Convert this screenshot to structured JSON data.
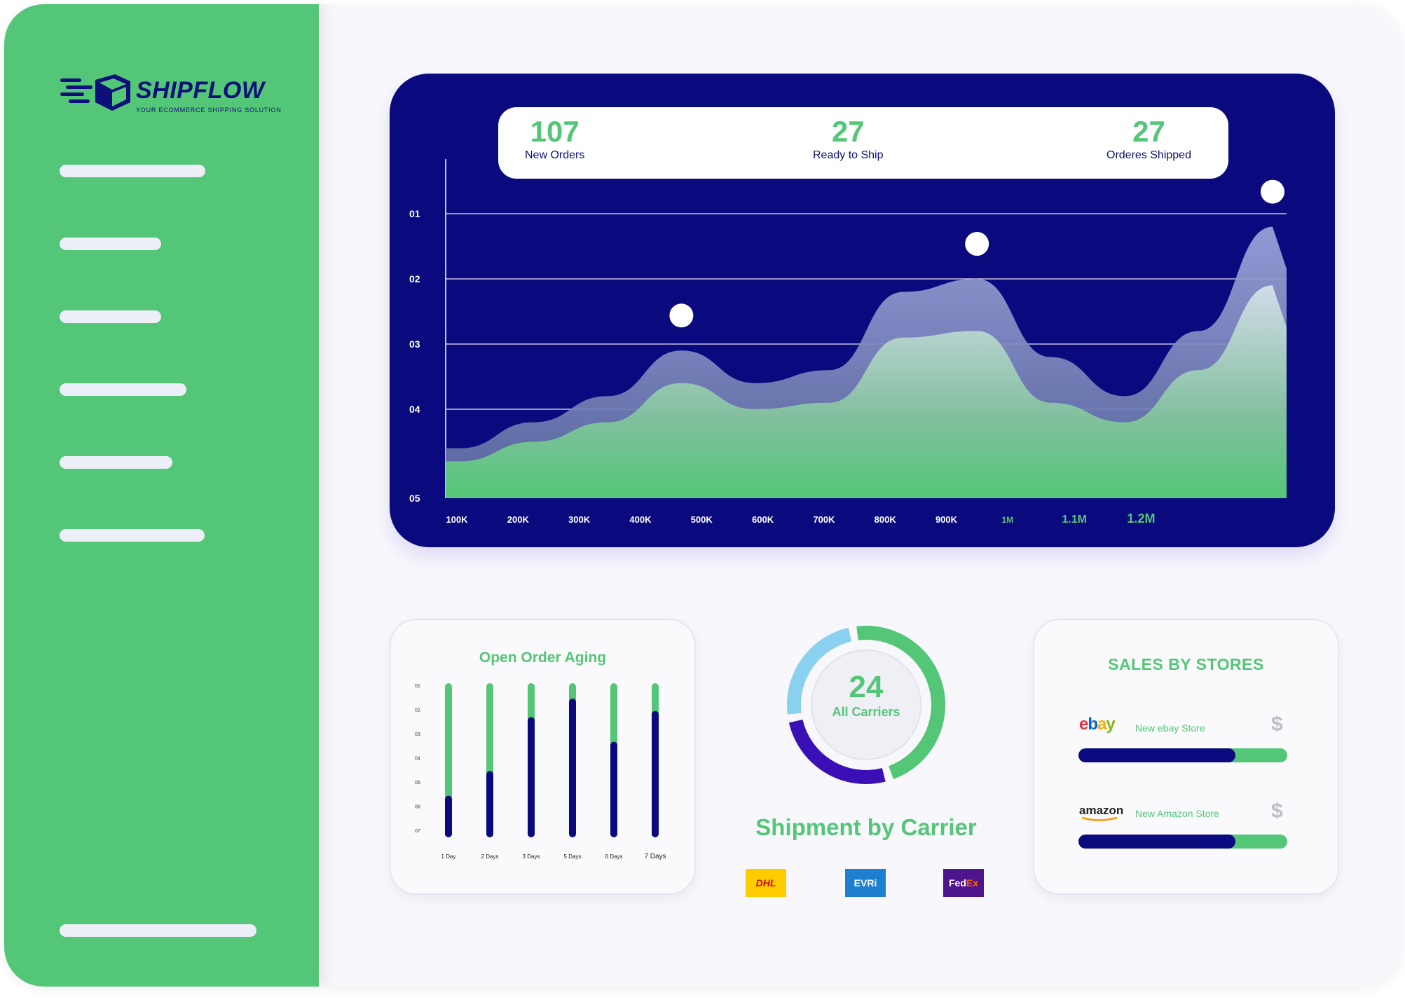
{
  "brand": {
    "name": "SHIPFLOW",
    "tagline": "YOUR ECOMMERCE SHIPPING SOLUTION"
  },
  "stats": [
    {
      "value": "107",
      "label": "New Orders"
    },
    {
      "value": "27",
      "label": "Ready to Ship"
    },
    {
      "value": "27",
      "label": "Orderes Shipped"
    }
  ],
  "chart_data": [
    {
      "type": "area",
      "y_tick_labels": [
        "01",
        "02",
        "03",
        "04",
        "05"
      ],
      "x_tick_labels": [
        "100K",
        "200K",
        "300K",
        "400K",
        "500K",
        "600K",
        "700K",
        "800K",
        "900K",
        "1M",
        "1.1M",
        "1.2M"
      ],
      "highlighted_x_labels": [
        "1M",
        "1.1M",
        "1.2M"
      ],
      "grid": true,
      "series": [
        {
          "x": [
            "100K",
            "200K",
            "300K",
            "400K",
            "500K",
            "600K",
            "700K",
            "800K",
            "900K",
            "1M",
            "1.1M",
            "1.2M"
          ],
          "values": [
            4.6,
            4.2,
            3.8,
            3.1,
            3.6,
            3.4,
            2.2,
            2.0,
            3.2,
            3.8,
            2.8,
            1.2
          ],
          "color": "#9aa0d8"
        },
        {
          "x": [
            "100K",
            "200K",
            "300K",
            "400K",
            "500K",
            "600K",
            "700K",
            "800K",
            "900K",
            "1M",
            "1.1M",
            "1.2M"
          ],
          "values": [
            4.8,
            4.5,
            4.2,
            3.6,
            4.0,
            3.9,
            2.9,
            2.8,
            3.9,
            4.2,
            3.4,
            2.1
          ],
          "color": "#54c677"
        }
      ],
      "markers": [
        {
          "x": "400K"
        },
        {
          "x": "800K"
        },
        {
          "x": "1.2M"
        }
      ]
    },
    {
      "type": "bar",
      "title": "Open Order Aging",
      "categories": [
        "1 Day",
        "2 Days",
        "3 Days",
        "5 Days",
        "6 Days",
        "7 Days"
      ],
      "y_tick_labels": [
        "01",
        "02",
        "03",
        "04",
        "05",
        "06",
        "07"
      ],
      "values": [
        0.27,
        0.43,
        0.78,
        0.9,
        0.62,
        0.82
      ],
      "colors": {
        "track": "#54c677",
        "fill": "#0a0a7e"
      }
    },
    {
      "type": "pie",
      "title": "Shipment by Carrier",
      "center_value": "24",
      "center_label": "All Carriers",
      "slices": [
        {
          "value": 0.48,
          "color": "#54c677"
        },
        {
          "value": 0.27,
          "color": "#3a0fb5"
        },
        {
          "value": 0.25,
          "color": "#8ad0ef"
        }
      ]
    }
  ],
  "carriers": [
    {
      "name": "DHL",
      "bg": "#ffcc00",
      "fg": "#d40511"
    },
    {
      "name": "EVRi",
      "bg": "#1e7fd0",
      "fg": "#ffffff"
    },
    {
      "name": "FedEx",
      "bg": "#4d148c",
      "fg": "#ffffff",
      "fg2": "#ff6200"
    }
  ],
  "sales_by_stores": {
    "title": "SALES BY STORES",
    "stores": [
      {
        "logo": "ebay",
        "name": "New ebay Store",
        "currency": "$",
        "progress": 0.75
      },
      {
        "logo": "amazon",
        "name": "New Amazon Store",
        "currency": "$",
        "progress": 0.75
      }
    ]
  },
  "colors": {
    "accent": "#54c677",
    "navy": "#0a0a7e",
    "sidebar": "#54c677",
    "background": "#f7f7fc"
  }
}
